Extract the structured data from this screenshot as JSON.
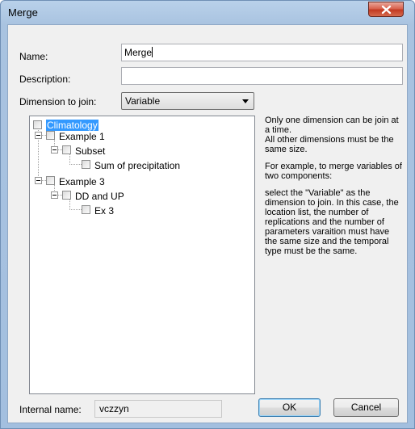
{
  "window": {
    "title": "Merge"
  },
  "form": {
    "name_label": "Name:",
    "name_value": "Merge",
    "description_label": "Description:",
    "description_value": "",
    "dimension_label": "Dimension to join:",
    "dimension_value": "Variable"
  },
  "tree": {
    "items": [
      {
        "label": "Climatology"
      },
      {
        "label": "Example 1"
      },
      {
        "label": "Subset"
      },
      {
        "label": "Sum of precipitation"
      },
      {
        "label": "Example 3"
      },
      {
        "label": "DD and UP"
      },
      {
        "label": "Ex 3"
      }
    ]
  },
  "help": {
    "p1": "Only one dimension can be join at a time.\nAll other dimensions must be the same size.",
    "p2": "For example, to merge variables of two components:",
    "p3": "select the \"Variable\" as the dimension to join. In this case, the location list, the number of replications and the number of parameters varaition must have the same size and the temporal type must be the same."
  },
  "footer": {
    "internal_name_label": "Internal name:",
    "internal_name_value": "vczzyn",
    "ok_label": "OK",
    "cancel_label": "Cancel"
  }
}
